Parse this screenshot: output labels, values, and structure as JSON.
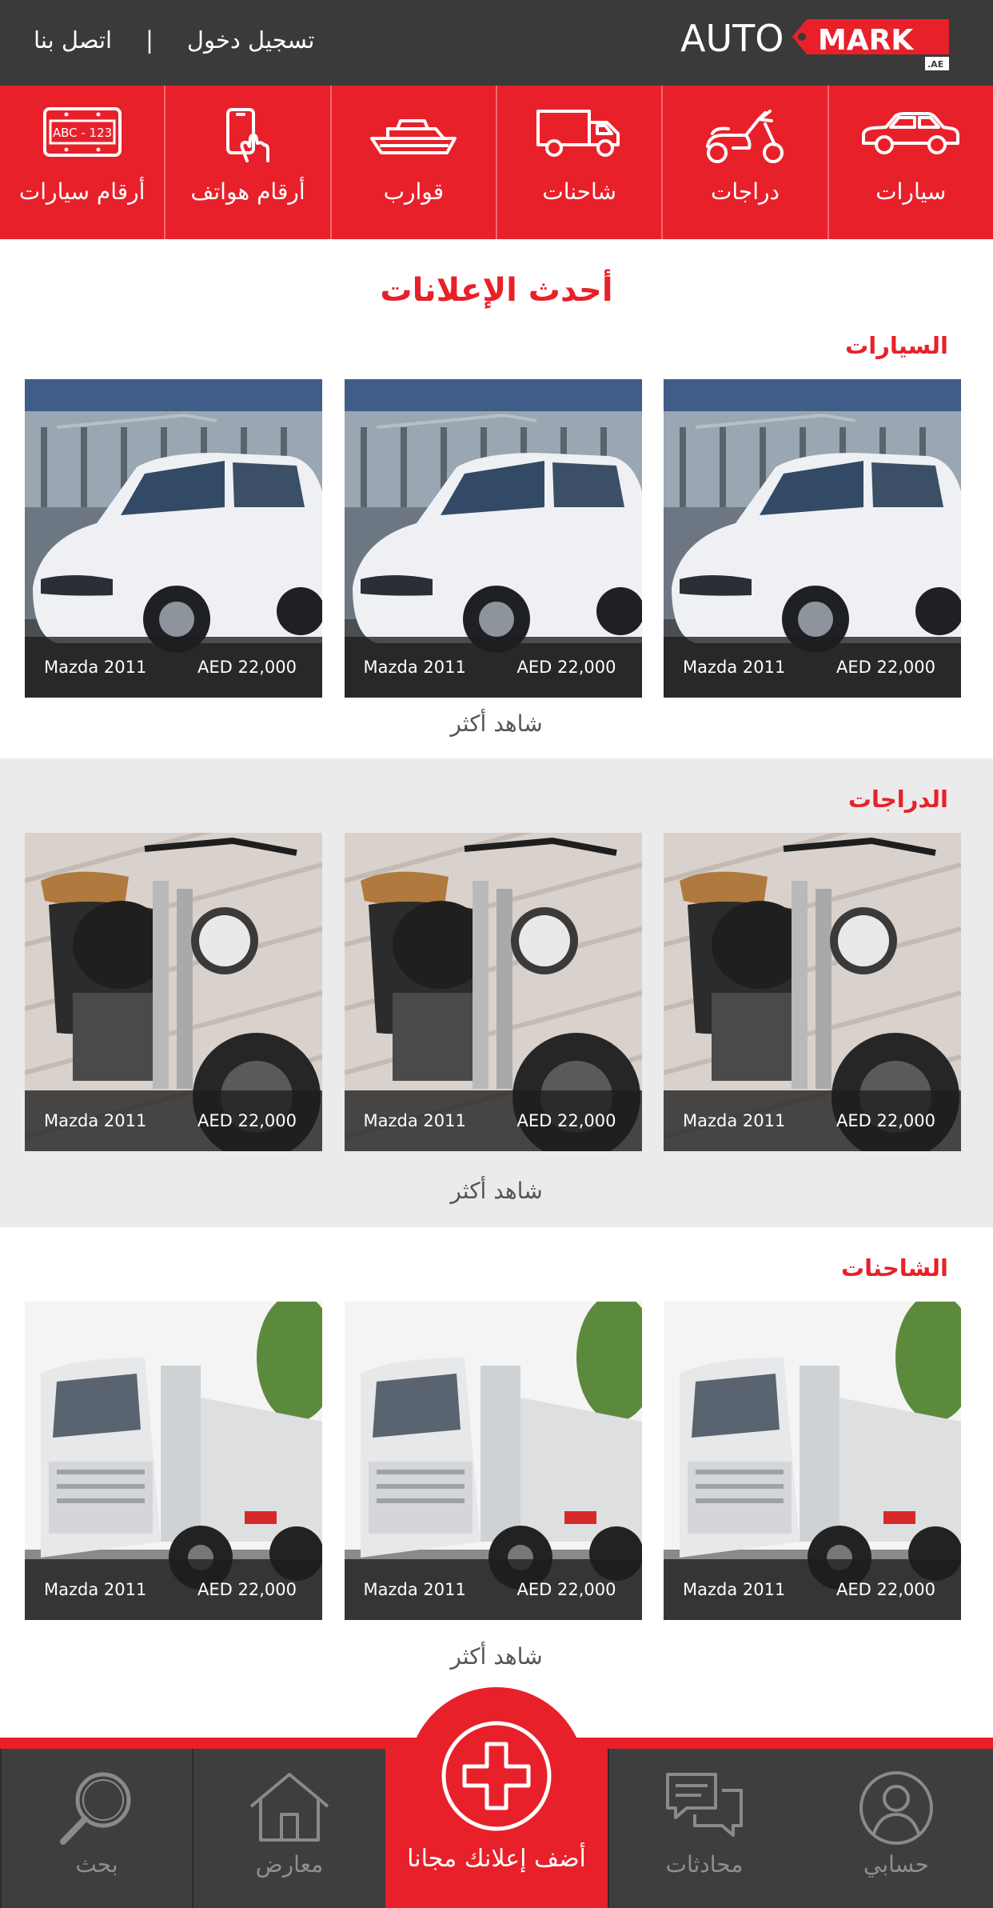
{
  "header": {
    "login_label": "تسجيل دخول",
    "separator": "|",
    "contact_label": "اتصل بنا",
    "logo": {
      "part1": "AUTO",
      "part2": "MARK",
      "suffix": ".AE"
    }
  },
  "categories": [
    {
      "label": "سيارات",
      "icon": "car-icon"
    },
    {
      "label": "دراجات",
      "icon": "scooter-icon"
    },
    {
      "label": "شاحنات",
      "icon": "truck-icon"
    },
    {
      "label": "قوارب",
      "icon": "boat-icon"
    },
    {
      "label": "أرقام هواتف",
      "icon": "phone-icon"
    },
    {
      "label": "أرقام سيارات",
      "icon": "plate-icon",
      "plate_text": "ABC - 123"
    }
  ],
  "main": {
    "title": "أحدث الإعلانات",
    "sections": [
      {
        "title": "السيارات",
        "see_more": "شاهد أكثر",
        "listings": [
          {
            "name": "Mazda 2011",
            "price": "AED 22,000"
          },
          {
            "name": "Mazda 2011",
            "price": "AED 22,000"
          },
          {
            "name": "Mazda 2011",
            "price": "AED 22,000"
          }
        ]
      },
      {
        "title": "الدراجات",
        "see_more": "شاهد أكثر",
        "listings": [
          {
            "name": "Mazda 2011",
            "price": "AED 22,000"
          },
          {
            "name": "Mazda 2011",
            "price": "AED 22,000"
          },
          {
            "name": "Mazda 2011",
            "price": "AED 22,000"
          }
        ]
      },
      {
        "title": "الشاحنات",
        "see_more": "شاهد أكثر",
        "listings": [
          {
            "name": "Mazda 2011",
            "price": "AED 22,000"
          },
          {
            "name": "Mazda 2011",
            "price": "AED 22,000"
          },
          {
            "name": "Mazda 2011",
            "price": "AED 22,000"
          }
        ]
      }
    ]
  },
  "bottom_nav": [
    {
      "label": "حسابي",
      "icon": "user-icon"
    },
    {
      "label": "محادثات",
      "icon": "chat-icon"
    },
    {
      "label": "أضف إعلانك مجانا",
      "icon": "plus-icon"
    },
    {
      "label": "معارض",
      "icon": "home-icon"
    },
    {
      "label": "بحث",
      "icon": "search-icon"
    }
  ],
  "colors": {
    "brand_red": "#e8202a",
    "header_dark": "#3a3a3a",
    "nav_dark": "#3e3e3e"
  }
}
